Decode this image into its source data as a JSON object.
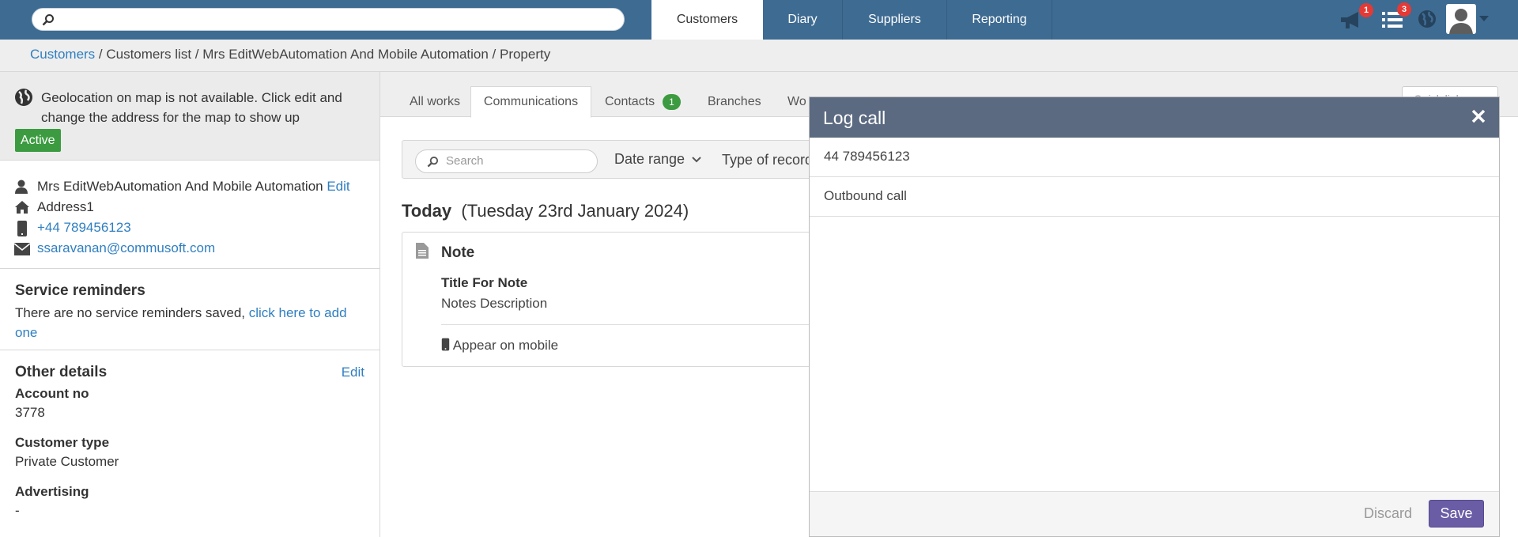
{
  "topbar": {
    "search_placeholder": "",
    "nav": [
      "Customers",
      "Diary",
      "Suppliers",
      "Reporting"
    ],
    "notifications_count": "1",
    "tasks_count": "3"
  },
  "breadcrumb": {
    "root": "Customers",
    "rest": " / Customers list / Mrs EditWebAutomation And Mobile Automation / Property"
  },
  "sidebar": {
    "geo_message": "Geolocation on map is not available. Click edit and change the address for the map to show up",
    "status": "Active",
    "name": "Mrs EditWebAutomation And Mobile Automation",
    "edit_label": "Edit",
    "address": "Address1",
    "phone": "+44 789456123",
    "email": "ssaravanan@commusoft.com",
    "reminders_title": "Service reminders",
    "reminders_text": "There are no service reminders saved, ",
    "reminders_link": "click here to add one",
    "other_title": "Other details",
    "other_edit": "Edit",
    "account_label": "Account no",
    "account_value": "3778",
    "type_label": "Customer type",
    "type_value": "Private Customer",
    "advertising_label": "Advertising",
    "advertising_value": "-"
  },
  "main": {
    "tabs": [
      "All works",
      "Communications",
      "Contacts",
      "Branches",
      "Wo"
    ],
    "contacts_count": "1",
    "quick_links": "Quick links",
    "filter": {
      "search_placeholder": "Search",
      "date_range": "Date range",
      "type_of_record": "Type of record"
    },
    "today_label": "Today",
    "today_date": "(Tuesday 23rd January 2024)",
    "note": {
      "title": "Note",
      "subject": "Title For Note",
      "description": "Notes Description",
      "mobile": "Appear on mobile"
    }
  },
  "modal": {
    "title": "Log call",
    "phone": "44 789456123",
    "call_type": "Outbound call",
    "discard": "Discard",
    "save": "Save"
  }
}
